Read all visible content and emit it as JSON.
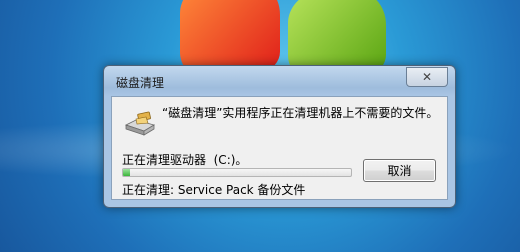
{
  "dialog": {
    "title": "磁盘清理",
    "message": "“磁盘清理”实用程序正在清理机器上不需要的文件。",
    "drive_line": "正在清理驱动器  (C:)。",
    "progress": 0.03,
    "status_line": "正在清理: Service Pack 备份文件",
    "cancel_label": "取消",
    "close_icon": "close-icon",
    "app_icon": "disk-cleanup-icon"
  },
  "colors": {
    "progress_fill": "#3ab53a",
    "desktop": "#1e6fb8"
  }
}
